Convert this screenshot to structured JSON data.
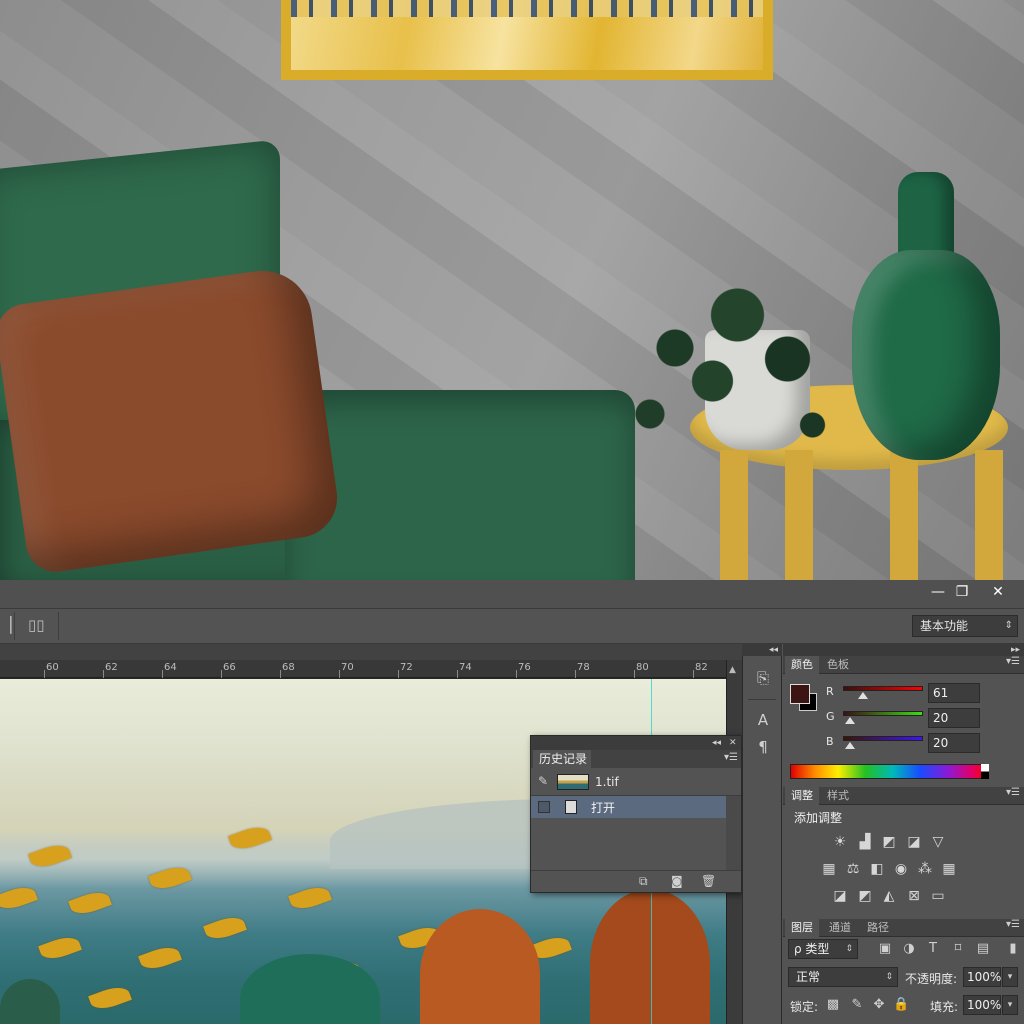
{
  "window": {
    "minimize_icon": "minimize-icon",
    "restore_icon": "restore-icon",
    "close_icon": "close-icon",
    "minimize_glyph": "—",
    "restore_glyph": "❐",
    "close_glyph": "✕"
  },
  "options_bar": {
    "workspace_label": "基本功能",
    "workspace_arrow": "⇕"
  },
  "ruler": {
    "numbers": [
      "60",
      "62",
      "64",
      "66",
      "68",
      "70",
      "72",
      "74",
      "76",
      "78",
      "80",
      "82"
    ]
  },
  "history_panel": {
    "collapse": "◂◂",
    "close": "✕",
    "tab_label": "历史记录",
    "menu": "▾☰",
    "snapshot_name": "1.tif",
    "state_name": "打开"
  },
  "color_panel": {
    "tabs": [
      "颜色",
      "色板"
    ],
    "fg_color": "#3d1414",
    "channels": [
      {
        "label": "R",
        "value": "61",
        "track": "linear-gradient(90deg,#3b0f0f,#ff0000)"
      },
      {
        "label": "G",
        "value": "20",
        "track": "linear-gradient(90deg,#3d0f14,#3ddc14)"
      },
      {
        "label": "B",
        "value": "20",
        "track": "linear-gradient(90deg,#3d1400,#3d14ff)"
      }
    ]
  },
  "adjustments_panel": {
    "tabs": [
      "调整",
      "样式"
    ],
    "title": "添加调整"
  },
  "layers_panel": {
    "tabs": [
      "图层",
      "通道",
      "路径"
    ],
    "filter_label": "ρ 类型",
    "blend_mode": "正常",
    "opacity_label": "不透明度:",
    "opacity_value": "100%",
    "lock_label": "锁定:",
    "fill_label": "填充:",
    "fill_value": "100%"
  },
  "colors": {
    "panel_bg": "#535353",
    "selected_state": "#5c6a80",
    "guide": "#29d6d6"
  }
}
